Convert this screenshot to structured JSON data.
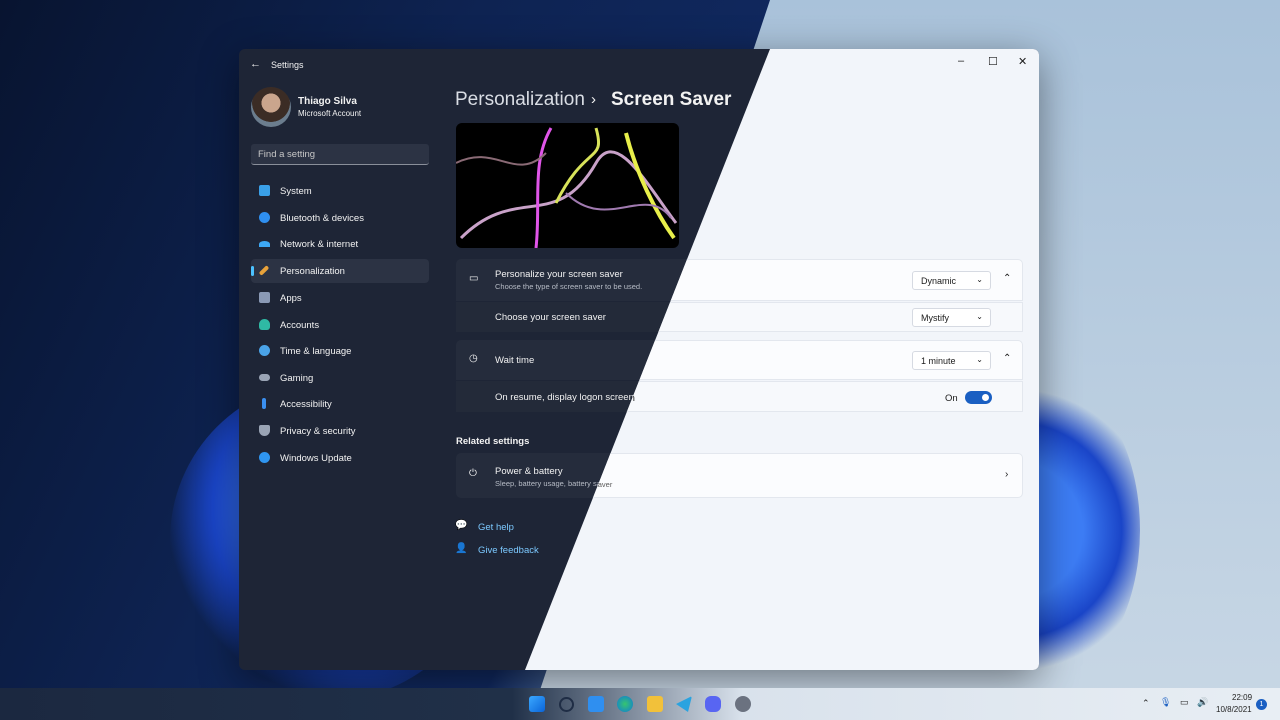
{
  "window": {
    "app_title": "Settings",
    "controls": {
      "minimize": "–",
      "maximize": "☐",
      "close": "✕"
    }
  },
  "user": {
    "name": "Thiago Silva",
    "account": "Microsoft Account"
  },
  "search": {
    "placeholder": "Find a setting"
  },
  "sidebar": {
    "items": [
      {
        "label": "System",
        "icon": "monitor-icon",
        "color": "#3aa0e8"
      },
      {
        "label": "Bluetooth & devices",
        "icon": "bluetooth-icon",
        "color": "#2f8ff0"
      },
      {
        "label": "Network & internet",
        "icon": "wifi-icon",
        "color": "#3da8f5"
      },
      {
        "label": "Personalization",
        "icon": "brush-icon",
        "color": "#e8a23a"
      },
      {
        "label": "Apps",
        "icon": "apps-icon",
        "color": "#8a99b5"
      },
      {
        "label": "Accounts",
        "icon": "person-icon",
        "color": "#2fb9a4"
      },
      {
        "label": "Time & language",
        "icon": "globe-clock-icon",
        "color": "#4aa3e8"
      },
      {
        "label": "Gaming",
        "icon": "gamepad-icon",
        "color": "#9aa4b5"
      },
      {
        "label": "Accessibility",
        "icon": "accessibility-icon",
        "color": "#3a8ff0"
      },
      {
        "label": "Privacy & security",
        "icon": "shield-icon",
        "color": "#9aa4b5"
      },
      {
        "label": "Windows Update",
        "icon": "update-icon",
        "color": "#2f95f0"
      }
    ],
    "selected": "Personalization"
  },
  "breadcrumb": {
    "parent": "Personalization",
    "separator": "›",
    "current": "Screen Saver"
  },
  "screen_saver_group": {
    "title": "Personalize your screen saver",
    "subtitle": "Choose the type of screen saver to be used.",
    "type_value": "Dynamic",
    "choose_label": "Choose your screen saver",
    "choose_value": "Mystify"
  },
  "wait_group": {
    "title": "Wait time",
    "value": "1 minute",
    "resume_label": "On resume, display logon screen",
    "resume_state": "On"
  },
  "related": {
    "heading": "Related settings",
    "power_title": "Power & battery",
    "power_subtitle": "Sleep, battery usage, battery saver"
  },
  "help": {
    "get_help": "Get help",
    "give_feedback": "Give feedback"
  },
  "taskbar": {
    "time": "22:09",
    "date": "10/8/2021",
    "notification_count": "1",
    "icons": [
      "start-icon",
      "search-icon",
      "widgets-icon",
      "edge-icon",
      "file-explorer-icon",
      "telegram-icon",
      "discord-icon",
      "settings-icon"
    ]
  },
  "colors": {
    "accent": "#4cc2ff",
    "toggle_on": "#2b73d6",
    "link_dark": "#7cc9ff",
    "link_light": "#1a5fc2"
  }
}
